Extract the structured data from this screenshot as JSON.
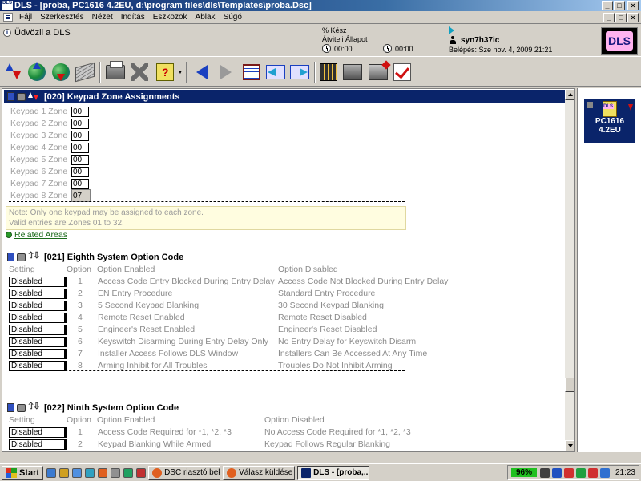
{
  "window": {
    "app_logo": "DLS",
    "title": "DLS - [proba, PC1616 4.2EU, d:\\program files\\dls\\Templates\\proba.Dsc]",
    "buttons": [
      "_",
      "□",
      "×"
    ]
  },
  "menu": {
    "items": [
      "Fájl",
      "Szerkesztés",
      "Nézet",
      "Indítás",
      "Eszközök",
      "Ablak",
      "Súgó"
    ],
    "mdi_buttons": [
      "_",
      "□",
      "×"
    ]
  },
  "status": {
    "welcome": "Üdvözli a DLS",
    "percent_label": "% Kész",
    "transfer_label": "Átviteli Állapot",
    "timer1": "00:00",
    "timer2": "00:00",
    "username": "syn7h37ic",
    "login": "Belépés: Sze nov. 4, 2009 21:21",
    "logo": "DLS"
  },
  "section20": {
    "title": "[020] Keypad Zone Assignments",
    "zones": [
      {
        "label": "Keypad 1 Zone",
        "value": "00"
      },
      {
        "label": "Keypad 2 Zone",
        "value": "00"
      },
      {
        "label": "Keypad 3 Zone",
        "value": "00"
      },
      {
        "label": "Keypad 4 Zone",
        "value": "00"
      },
      {
        "label": "Keypad 5 Zone",
        "value": "00"
      },
      {
        "label": "Keypad 6 Zone",
        "value": "00"
      },
      {
        "label": "Keypad 7 Zone",
        "value": "00"
      },
      {
        "label": "Keypad 8 Zone",
        "value": "07"
      }
    ],
    "note_line1": "Note: Only one keypad may be assigned to each zone.",
    "note_line2": "Valid entries are Zones 01 to 32.",
    "related": "Related Areas"
  },
  "section21": {
    "title": "[021] Eighth System Option Code",
    "headers": {
      "setting": "Setting",
      "option": "Option",
      "enabled": "Option Enabled",
      "disabled": "Option Disabled"
    },
    "rows": [
      {
        "setting": "Disabled",
        "option": "1",
        "enabled": "Access Code Entry Blocked During Entry Delay",
        "disabled": "Access Code Not Blocked During Entry Delay"
      },
      {
        "setting": "Disabled",
        "option": "2",
        "enabled": "EN Entry Procedure",
        "disabled": "Standard Entry Procedure"
      },
      {
        "setting": "Disabled",
        "option": "3",
        "enabled": "5 Second Keypad Blanking",
        "disabled": "30 Second Keypad Blanking"
      },
      {
        "setting": "Disabled",
        "option": "4",
        "enabled": "Remote Reset Enabled",
        "disabled": "Remote Reset Disabled"
      },
      {
        "setting": "Disabled",
        "option": "5",
        "enabled": "Engineer's Reset Enabled",
        "disabled": "Engineer's Reset Disabled"
      },
      {
        "setting": "Disabled",
        "option": "6",
        "enabled": "Keyswitch Disarming During Entry Delay Only",
        "disabled": "No Entry Delay for Keyswitch Disarm"
      },
      {
        "setting": "Disabled",
        "option": "7",
        "enabled": "Installer Access Follows DLS Window",
        "disabled": "Installers Can Be Accessed At Any Time"
      },
      {
        "setting": "Disabled",
        "option": "8",
        "enabled": "Arming Inhibit for All Troubles",
        "disabled": "Troubles Do Not Inhibit Arming"
      }
    ]
  },
  "section22": {
    "title": "[022] Ninth System Option Code",
    "headers": {
      "setting": "Setting",
      "option": "Option",
      "enabled": "Option Enabled",
      "disabled": "Option Disabled"
    },
    "rows": [
      {
        "setting": "Disabled",
        "option": "1",
        "enabled": "Access Code Required for *1, *2, *3",
        "disabled": "No Access Code Required for *1, *2, *3"
      },
      {
        "setting": "Disabled",
        "option": "2",
        "enabled": "Keypad Blanking While Armed",
        "disabled": "Keypad Follows Regular Blanking"
      }
    ]
  },
  "right_panel": {
    "item_line1": "PC1616",
    "item_line2": "4.2EU"
  },
  "taskbar": {
    "start": "Start",
    "tasks": [
      "DSC riasztó bek...",
      "Válasz küldése ...",
      "DLS - [proba,..."
    ],
    "battery": "96%",
    "time": "21:23"
  }
}
